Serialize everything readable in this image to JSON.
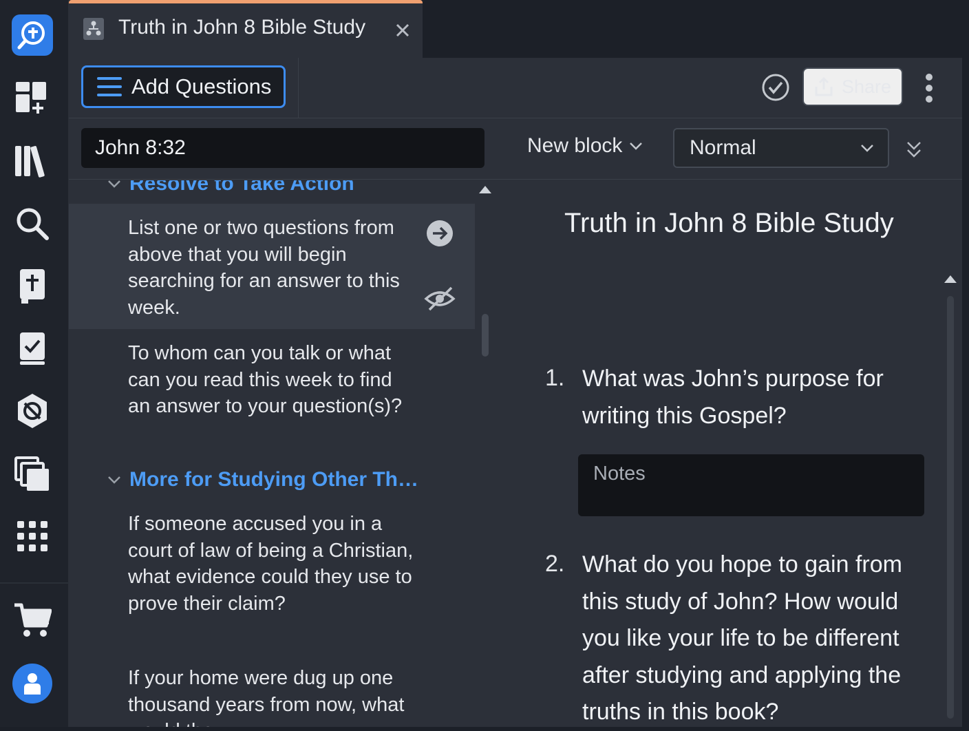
{
  "tab": {
    "title": "Truth in John 8 Bible Study"
  },
  "toolbar": {
    "add_questions_label": "Add Questions",
    "share_label": "Share"
  },
  "search": {
    "reference_value": "John 8:32",
    "new_block_label": "New block",
    "style_value": "Normal"
  },
  "question_list": {
    "sections": [
      {
        "title": "Resolve to Take Action"
      },
      {
        "title": "More for Studying Other Th…"
      }
    ],
    "items": [
      {
        "text": "List one or two questions from above that you will begin searching for an answer to this week."
      },
      {
        "text": "To whom can you talk or what can you read this week to find an answer to your question(s)?"
      },
      {
        "text": "If someone accused you in a court of law of being a Christian, what evidence could they use to prove their claim?"
      },
      {
        "text": "If your home were dug up one thousand years from now, what would the"
      }
    ]
  },
  "document": {
    "title": "Truth in John 8 Bible Study",
    "questions": [
      {
        "number": "1.",
        "text": "What was John’s purpose for writing this Gospel?"
      },
      {
        "number": "2.",
        "text": "What do you hope to gain from this study of John? How would you like your life to be different after studying and applying the truths in this book?"
      }
    ],
    "notes_placeholder": "Notes"
  },
  "colors": {
    "accent": "#3d8cf0",
    "section_heading": "#4d9cf5",
    "tab_highlight": "#f0a070"
  }
}
